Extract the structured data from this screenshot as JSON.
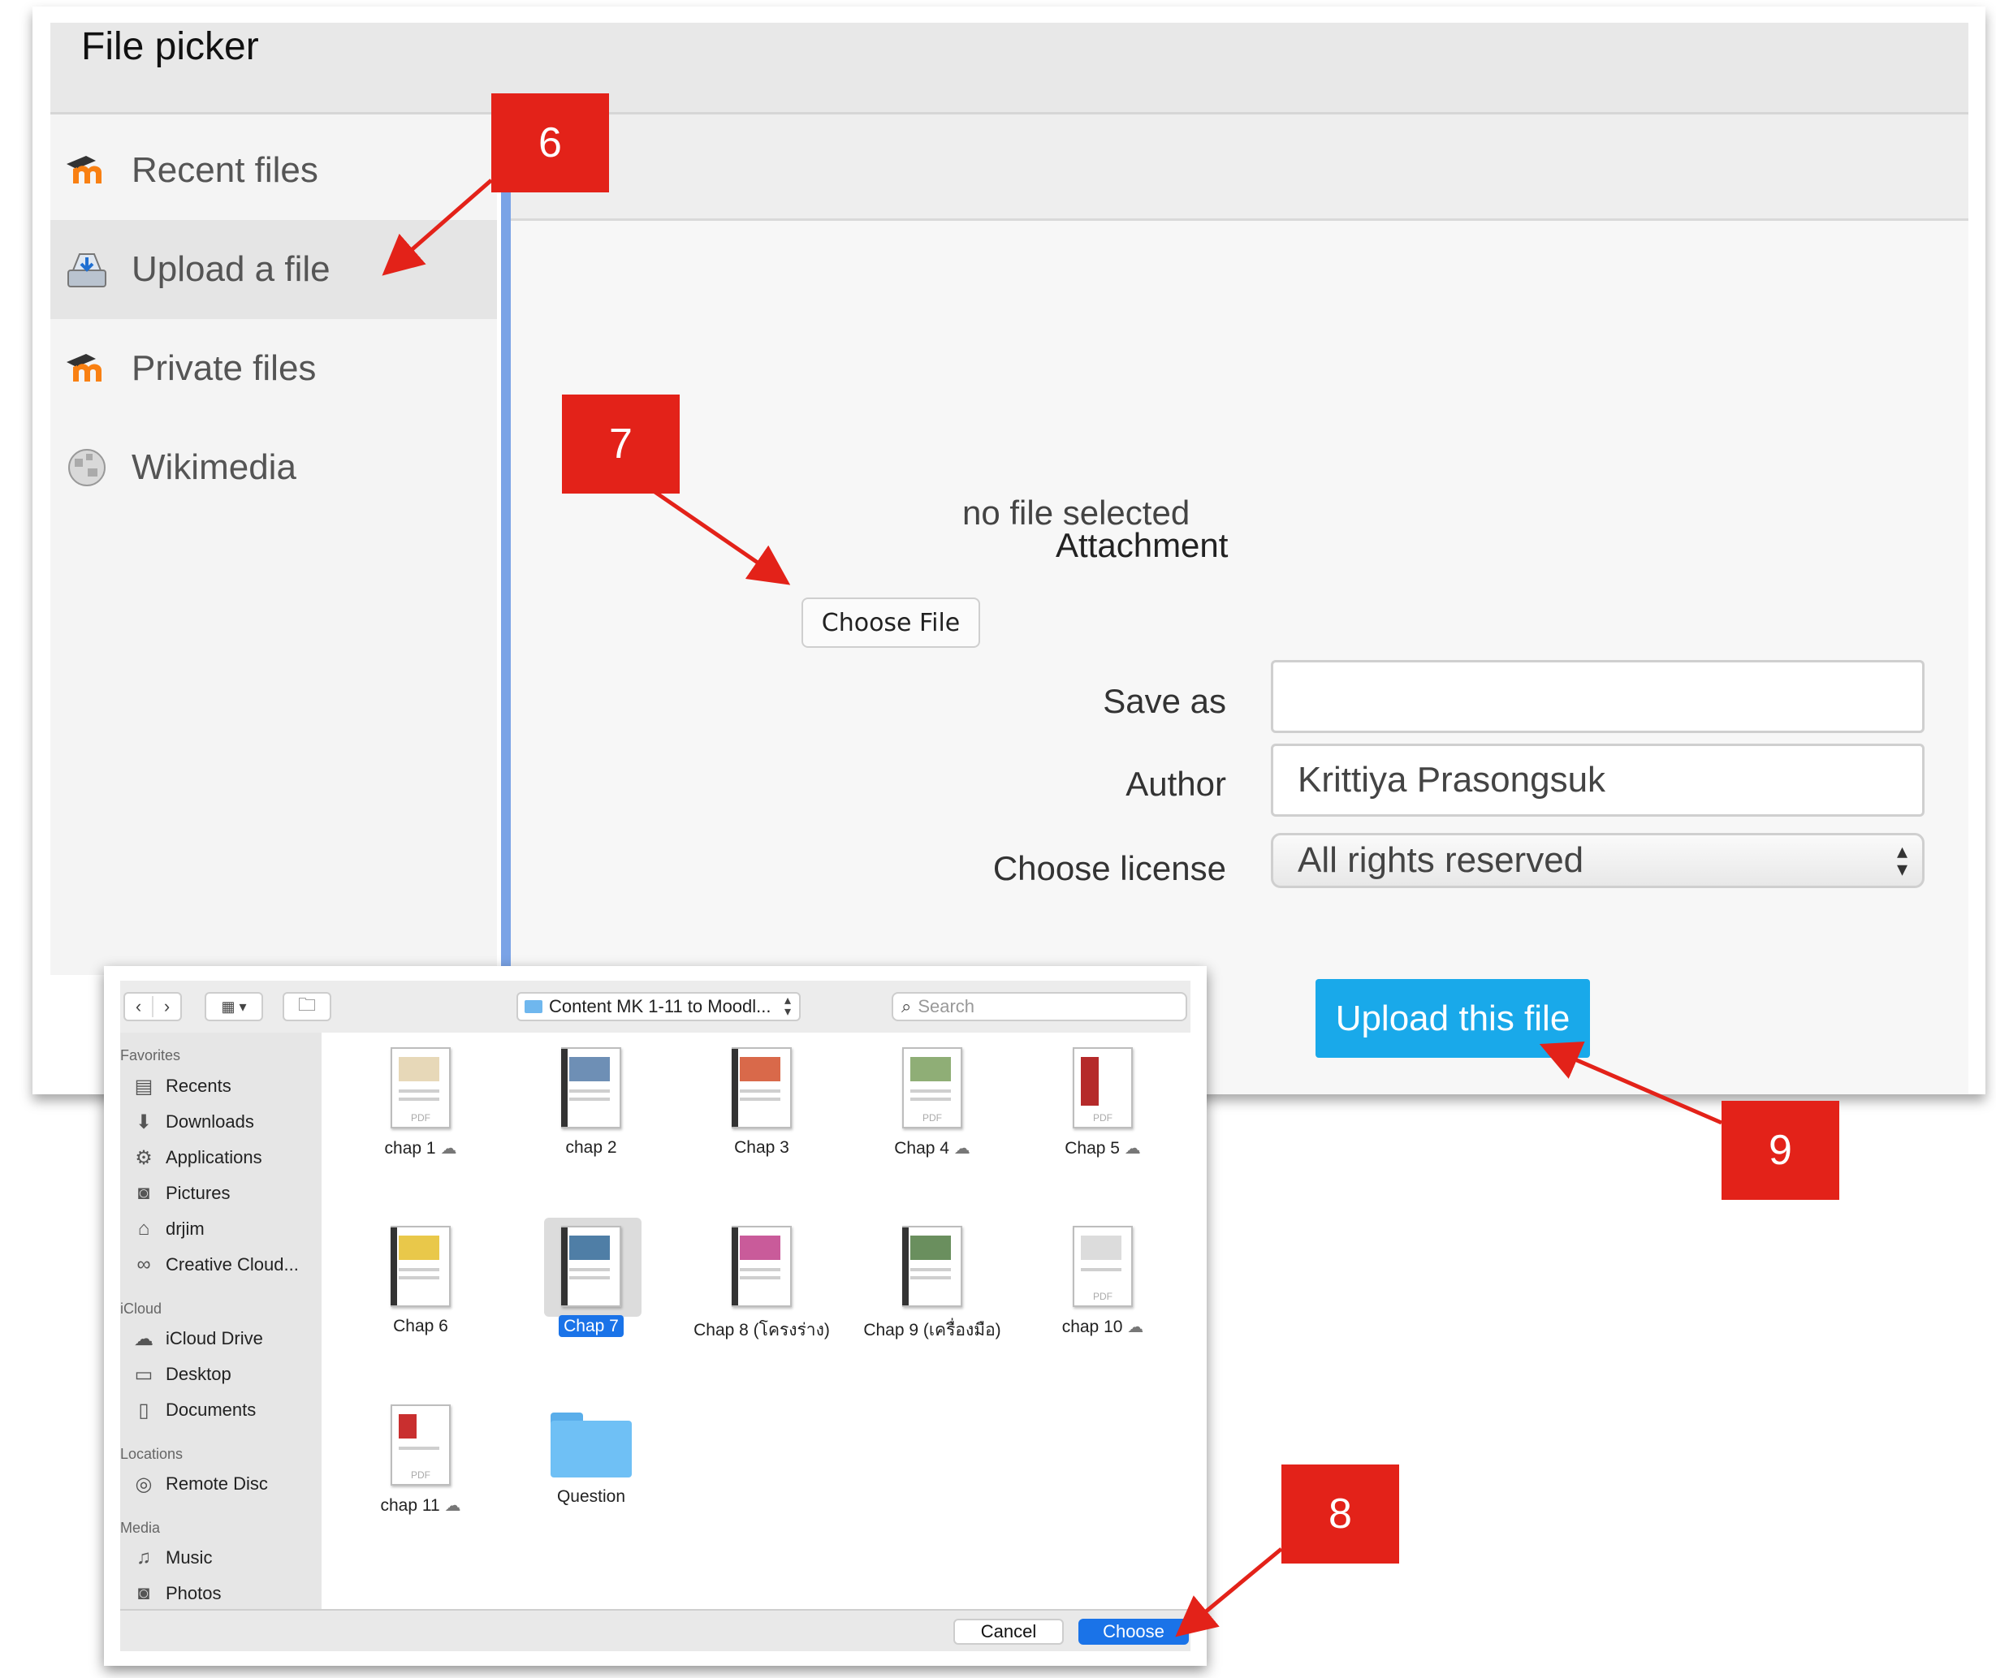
{
  "file_picker": {
    "title": "File picker",
    "sidebar": [
      {
        "label": "Recent files",
        "icon": "moodle-icon"
      },
      {
        "label": "Upload a file",
        "icon": "upload-icon"
      },
      {
        "label": "Private files",
        "icon": "moodle-icon"
      },
      {
        "label": "Wikimedia",
        "icon": "wikimedia-globe-icon"
      }
    ],
    "no_file_text": "no file selected",
    "attachment_label": "Attachment",
    "choose_file_label": "Choose File",
    "save_as_label": "Save as",
    "save_as_value": "",
    "author_label": "Author",
    "author_value": "Krittiya Prasongsuk",
    "license_label": "Choose license",
    "license_value": "All rights reserved",
    "upload_button": "Upload this file",
    "upload_button_color": "#19a9ea"
  },
  "dialog": {
    "location": "Content MK 1-11 to Moodl...",
    "search_placeholder": "Search",
    "sections": {
      "favorites": "Favorites",
      "icloud": "iCloud",
      "locations": "Locations",
      "media": "Media"
    },
    "favorites": [
      "Recents",
      "Downloads",
      "Applications",
      "Pictures",
      "drjim",
      "Creative Cloud..."
    ],
    "icloud_items": [
      "iCloud Drive",
      "Desktop",
      "Documents"
    ],
    "location_items": [
      "Remote Disc"
    ],
    "media_items": [
      "Music",
      "Photos"
    ],
    "files": [
      {
        "name": "chap 1",
        "cloud": true
      },
      {
        "name": "chap 2",
        "cloud": false
      },
      {
        "name": "Chap 3",
        "cloud": false
      },
      {
        "name": "Chap 4",
        "cloud": true
      },
      {
        "name": "Chap 5",
        "cloud": true
      },
      {
        "name": "Chap 6",
        "cloud": false
      },
      {
        "name": "Chap 7",
        "cloud": false,
        "selected": true
      },
      {
        "name": "Chap 8  (โครงร่าง)",
        "cloud": false
      },
      {
        "name": "Chap 9 (เครื่องมือ)",
        "cloud": false
      },
      {
        "name": "chap 10",
        "cloud": true
      },
      {
        "name": "chap 11",
        "cloud": true
      },
      {
        "name": "Question",
        "cloud": false,
        "folder": true
      }
    ],
    "cancel_label": "Cancel",
    "choose_label": "Choose",
    "accent_color": "#1a73e8"
  },
  "annotations": {
    "step6": "6",
    "step7": "7",
    "step8": "8",
    "step9": "9",
    "badge_color": "#e32219"
  }
}
